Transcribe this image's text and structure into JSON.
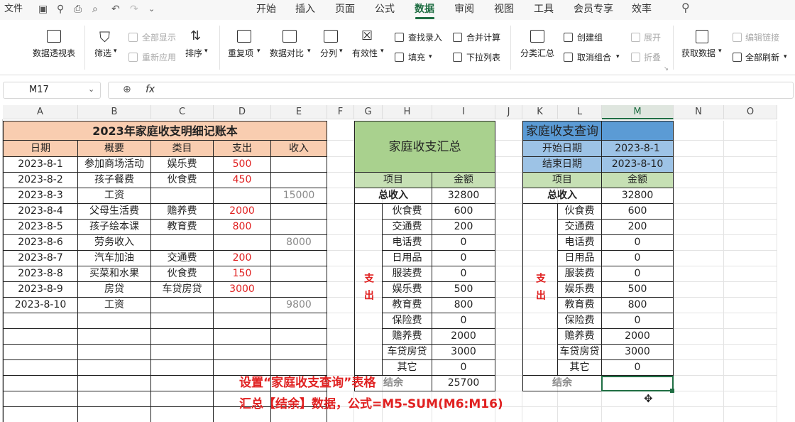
{
  "menubar": {
    "file_label": "文件",
    "tabs": [
      "开始",
      "插入",
      "页面",
      "公式",
      "数据",
      "审阅",
      "视图",
      "工具",
      "会员专享",
      "效率"
    ],
    "active_tab": "数据"
  },
  "ribbon": {
    "pivot_label": "数据透视表",
    "filter_label": "筛选",
    "show_all_label": "全部显示",
    "reapply_label": "重新应用",
    "sort_label": "排序",
    "duplicates_label": "重复项",
    "compare_label": "数据对比",
    "split_label": "分列",
    "validity_label": "有效性",
    "lookup_entry_label": "查找录入",
    "fill_label": "填充",
    "merge_calc_label": "合并计算",
    "dropdown_list_label": "下拉列表",
    "subtotal_label": "分类汇总",
    "create_group_label": "创建组",
    "ungroup_label": "取消组合",
    "expand_label": "展开",
    "collapse_label": "折叠",
    "get_data_label": "获取数据",
    "edit_links_label": "编辑链接",
    "refresh_all_label": "全部刷新"
  },
  "formula_bar": {
    "name_box": "M17",
    "fx_label": "fx",
    "formula": ""
  },
  "columns": [
    "A",
    "B",
    "C",
    "D",
    "E",
    "F",
    "G",
    "H",
    "I",
    "J",
    "K",
    "L",
    "M",
    "N",
    "O"
  ],
  "ledger": {
    "title": "2023年家庭收支明细记账本",
    "headers": [
      "日期",
      "概要",
      "类目",
      "支出",
      "收入"
    ],
    "rows": [
      [
        "2023-8-1",
        "参加商场活动",
        "娱乐费",
        "500",
        ""
      ],
      [
        "2023-8-2",
        "孩子餐费",
        "伙食费",
        "450",
        ""
      ],
      [
        "2023-8-3",
        "工资",
        "",
        "",
        "15000"
      ],
      [
        "2023-8-4",
        "父母生活费",
        "赡养费",
        "2000",
        ""
      ],
      [
        "2023-8-5",
        "孩子绘本课",
        "教育费",
        "800",
        ""
      ],
      [
        "2023-8-6",
        "劳务收入",
        "",
        "",
        "8000"
      ],
      [
        "2023-8-7",
        "汽车加油",
        "交通费",
        "200",
        ""
      ],
      [
        "2023-8-8",
        "买菜和水果",
        "伙食费",
        "150",
        ""
      ],
      [
        "2023-8-9",
        "房贷",
        "车贷房贷",
        "3000",
        ""
      ],
      [
        "2023-8-10",
        "工资",
        "",
        "",
        "9800"
      ]
    ]
  },
  "summary": {
    "title": "家庭收支汇总",
    "item_header": "项目",
    "amount_header": "金额",
    "total_income_label": "总收入",
    "total_income": "32800",
    "expense_label": "支出",
    "items": [
      {
        "name": "伙食费",
        "amount": "600"
      },
      {
        "name": "交通费",
        "amount": "200"
      },
      {
        "name": "电话费",
        "amount": "0"
      },
      {
        "name": "日用品",
        "amount": "0"
      },
      {
        "name": "服装费",
        "amount": "0"
      },
      {
        "name": "娱乐费",
        "amount": "500"
      },
      {
        "name": "教育费",
        "amount": "800"
      },
      {
        "name": "保险费",
        "amount": "0"
      },
      {
        "name": "赡养费",
        "amount": "2000"
      },
      {
        "name": "车贷房贷",
        "amount": "3000"
      },
      {
        "name": "其它",
        "amount": "0"
      }
    ],
    "balance_label": "结余",
    "balance": "25700"
  },
  "query": {
    "title": "家庭收支查询",
    "start_label": "开始日期",
    "start_date": "2023-8-1",
    "end_label": "结束日期",
    "end_date": "2023-8-10",
    "item_header": "项目",
    "amount_header": "金额",
    "total_income_label": "总收入",
    "total_income": "32800",
    "expense_label": "支出",
    "items": [
      {
        "name": "伙食费",
        "amount": "600"
      },
      {
        "name": "交通费",
        "amount": "200"
      },
      {
        "name": "电话费",
        "amount": "0"
      },
      {
        "name": "日用品",
        "amount": "0"
      },
      {
        "name": "服装费",
        "amount": "0"
      },
      {
        "name": "娱乐费",
        "amount": "500"
      },
      {
        "name": "教育费",
        "amount": "800"
      },
      {
        "name": "保险费",
        "amount": "0"
      },
      {
        "name": "赡养费",
        "amount": "2000"
      },
      {
        "name": "车贷房贷",
        "amount": "3000"
      },
      {
        "name": "其它",
        "amount": "0"
      }
    ],
    "balance_label": "结余",
    "balance": ""
  },
  "annotation": {
    "line1": "设置“家庭收支查询”表格",
    "line2": "汇总【结余】数据，公式=M5-SUM(M6:M16)"
  },
  "colors": {
    "accent": "#1f6e43",
    "annotation": "#e02020",
    "peach": "#f9cdb0",
    "green": "#a9d18e",
    "blue": "#5b9bd5"
  }
}
